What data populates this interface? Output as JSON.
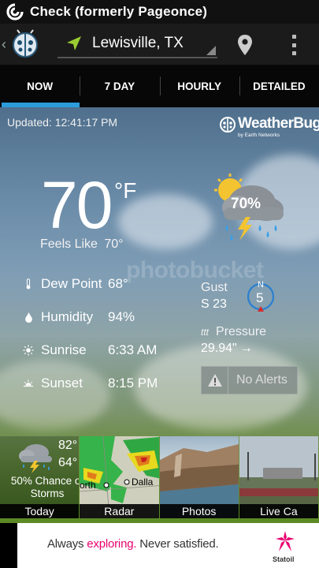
{
  "status_bar": {
    "notification_title": "Check (formerly Pageonce)"
  },
  "action_bar": {
    "location": "Lewisville, TX"
  },
  "tabs": [
    {
      "label": "NOW",
      "active": true
    },
    {
      "label": "7 DAY",
      "active": false
    },
    {
      "label": "HOURLY",
      "active": false
    },
    {
      "label": "DETAILED",
      "active": false
    }
  ],
  "conditions": {
    "updated": "Updated: 12:41:17 PM",
    "brand": "WeatherBug",
    "brand_sub": "by Earth Networks",
    "temperature": "70",
    "unit": "°F",
    "feels_like_label": "Feels Like",
    "feels_like_value": "70°",
    "precip_chance": "70%",
    "dew_point_label": "Dew Point",
    "dew_point_value": "68°",
    "humidity_label": "Humidity",
    "humidity_value": "94%",
    "sunrise_label": "Sunrise",
    "sunrise_value": "6:33 AM",
    "sunset_label": "Sunset",
    "sunset_value": "8:15 PM",
    "gust_label": "Gust",
    "gust_value": "S 23",
    "wind_direction": "N",
    "wind_speed": "5",
    "pressure_label": "Pressure",
    "pressure_value": "29.94\"",
    "pressure_trend": "→",
    "alerts_label": "No Alerts"
  },
  "thumbnails": {
    "today": {
      "caption": "Today",
      "high": "82°",
      "low": "64°",
      "chance": "50% Chance of Storms"
    },
    "radar": {
      "caption": "Radar",
      "city1": "orth",
      "city2": "Dalla"
    },
    "photos": {
      "caption": "Photos"
    },
    "live": {
      "caption": "Live Ca"
    }
  },
  "ad": {
    "text_1": "Always ",
    "text_highlight": "exploring.",
    "text_2": " Never satisfied.",
    "brand": "Statoil"
  },
  "colors": {
    "tab_indicator": "#2b9bd9",
    "location_arrow": "#9acd32",
    "ad_highlight": "#e8006f"
  }
}
